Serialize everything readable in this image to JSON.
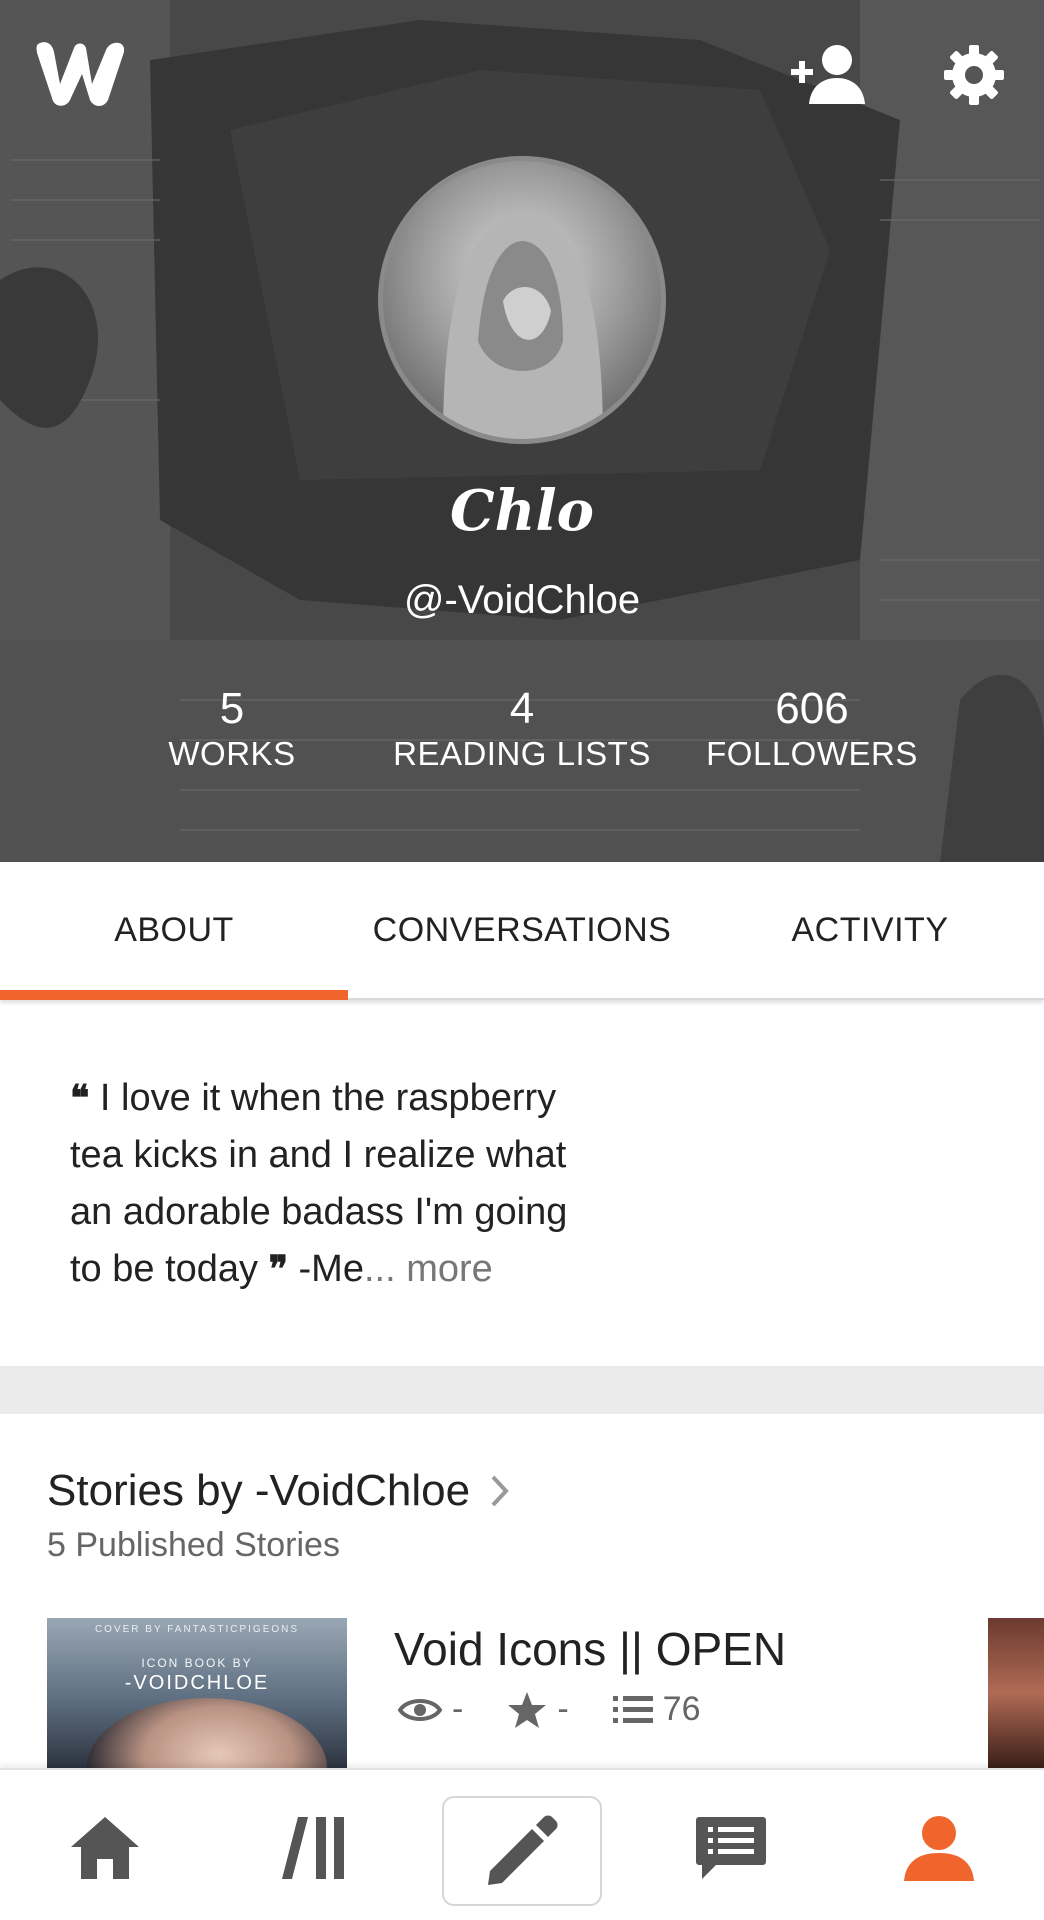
{
  "colors": {
    "accent": "#f0652b",
    "header_text": "#ffffff",
    "text_primary": "#222222",
    "text_secondary": "#666666",
    "icon_gray": "#555555"
  },
  "header": {
    "logo_icon": "wattpad-w-logo",
    "follow_icon": "add-person-icon",
    "settings_icon": "gear-icon",
    "display_name": "Chlo",
    "username": "@-VoidChloe",
    "stats": [
      {
        "value": "5",
        "label": "WORKS"
      },
      {
        "value": "4",
        "label": "READING LISTS"
      },
      {
        "value": "606",
        "label": "FOLLOWERS"
      }
    ]
  },
  "tabs": [
    {
      "label": "ABOUT",
      "active": true
    },
    {
      "label": "CONVERSATIONS",
      "active": false
    },
    {
      "label": "ACTIVITY",
      "active": false
    }
  ],
  "about": {
    "open_quote": "❝",
    "line1": " I love it when the raspberry",
    "line2": "tea kicks in and I realize what",
    "line3": "an adorable badass I'm going",
    "line4_start": "to be today ",
    "close_quote": "❞",
    "line4_end": " -Me",
    "more": "... more"
  },
  "stories": {
    "title": "Stories by -VoidChloe",
    "subtitle": "5 Published Stories",
    "items": [
      {
        "title": "Void Icons || OPEN",
        "cover_credit": "COVER BY FANTASTICPIGEONS",
        "cover_small": "ICON BOOK BY",
        "cover_big": "-VOIDCHLOE",
        "views": "-",
        "votes": "-",
        "parts": "76"
      }
    ]
  },
  "bottom_nav": [
    {
      "name": "home",
      "icon": "home-icon",
      "active": false
    },
    {
      "name": "library",
      "icon": "library-icon",
      "active": false
    },
    {
      "name": "write",
      "icon": "pencil-icon",
      "active": false
    },
    {
      "name": "messages",
      "icon": "message-icon",
      "active": false
    },
    {
      "name": "profile",
      "icon": "person-icon",
      "active": true
    }
  ]
}
